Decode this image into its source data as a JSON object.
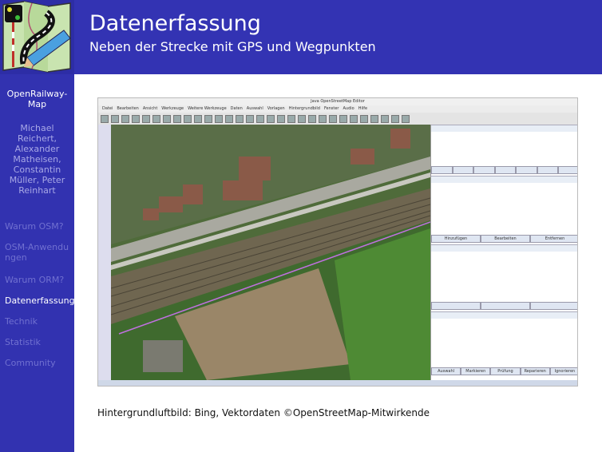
{
  "header": {
    "title": "Datenerfassung",
    "subtitle": "Neben der Strecke mit GPS und Wegpunkten"
  },
  "sidebar": {
    "project": "OpenRailway-Map",
    "authors": "Michael Reichert, Alexander Matheisen, Constantin Müller, Peter Reinhart",
    "items": [
      {
        "label": "Warum OSM?",
        "active": false
      },
      {
        "label": "OSM-Anwendungen",
        "active": false
      },
      {
        "label": "Warum ORM?",
        "active": false
      },
      {
        "label": "Datenerfassung",
        "active": true
      },
      {
        "label": "Technik",
        "active": false
      },
      {
        "label": "Statistik",
        "active": false
      },
      {
        "label": "Community",
        "active": false
      }
    ]
  },
  "screenshot": {
    "window_title": "Java OpenStreetMap Editor",
    "menu": [
      "Datei",
      "Bearbeiten",
      "Ansicht",
      "Werkzeuge",
      "Weitere Werkzeuge",
      "Daten",
      "Auswahl",
      "Vorlagen",
      "Hintergrundbild",
      "Fenster",
      "Audio",
      "Hilfe"
    ],
    "tag_buttons": [
      "Hinzufügen",
      "Bearbeiten",
      "Entfernen"
    ],
    "validation_tabs": [
      "Auswahl",
      "Markieren",
      "Prüfung",
      "Reparieren",
      "Ignorieren"
    ]
  },
  "caption": "Hintergrundluftbild: Bing, Vektordaten ©OpenStreetMap-Mitwirkende",
  "colors": {
    "frame": "#3333b3",
    "nav_inactive": "#7070d0",
    "nav_active": "#ffffff"
  }
}
